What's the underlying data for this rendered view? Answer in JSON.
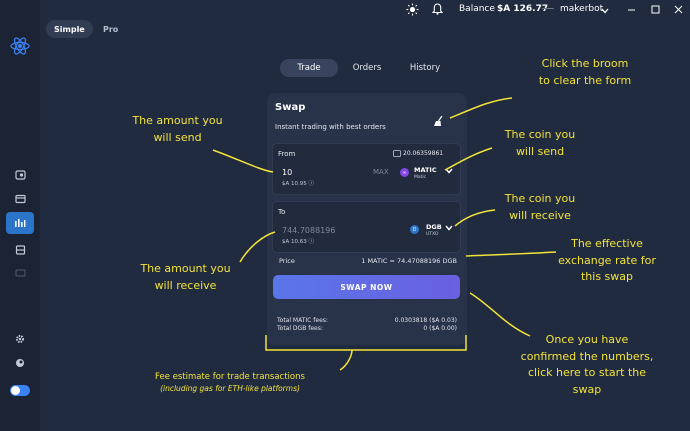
{
  "modes": [
    {
      "label": "Simple",
      "active": true
    },
    {
      "label": "Pro",
      "active": false
    }
  ],
  "topbar": {
    "balance_label": "Balance",
    "balance_value": "$A 126.77",
    "user": "makerbot"
  },
  "tabs": [
    {
      "label": "Trade",
      "active": true
    },
    {
      "label": "Orders",
      "active": false
    },
    {
      "label": "History",
      "active": false
    }
  ],
  "swap": {
    "title": "Swap",
    "subtitle": "Instant trading with best orders",
    "from": {
      "label": "From",
      "balance": "20.06359861",
      "amount": "10",
      "usd": "$A 10.95",
      "max_label": "MAX",
      "coin": "MATIC",
      "coin_sub": "Matic"
    },
    "to": {
      "label": "To",
      "amount": "744.7088196",
      "usd": "$A 10.63",
      "coin": "DGB",
      "coin_sub": "UTXO"
    },
    "price_label": "Price",
    "price_value": "1 MATIC = 74.47088196 DGB",
    "button_label": "SWAP NOW",
    "fees": [
      {
        "label": "Total MATIC fees:",
        "value": "0.0303818 ($A 0.03)"
      },
      {
        "label": "Total DGB fees:",
        "value": "0 ($A 0.00)"
      }
    ]
  },
  "annotations": {
    "broom_1": "Click the broom",
    "broom_2": "to clear the form",
    "send_amount_1": "The amount you",
    "send_amount_2": "will send",
    "send_coin_1": "The coin you",
    "send_coin_2": "will send",
    "recv_coin_1": "The coin you",
    "recv_coin_2": "will receive",
    "recv_amount_1": "The amount you",
    "recv_amount_2": "will receive",
    "rate_1": "The effective",
    "rate_2": "exchange rate for",
    "rate_3": "this swap",
    "swap_1": "Once you have",
    "swap_2": "confirmed the numbers,",
    "swap_3": "click here to start the",
    "swap_4": "swap",
    "fee_1": "Fee estimate for trade transactions",
    "fee_2": "(including gas for ETH-like platforms)"
  },
  "colors": {
    "background": "#212b3f",
    "card": "#283249",
    "accent": "#5a76e8",
    "annotation": "#f2e33a"
  }
}
